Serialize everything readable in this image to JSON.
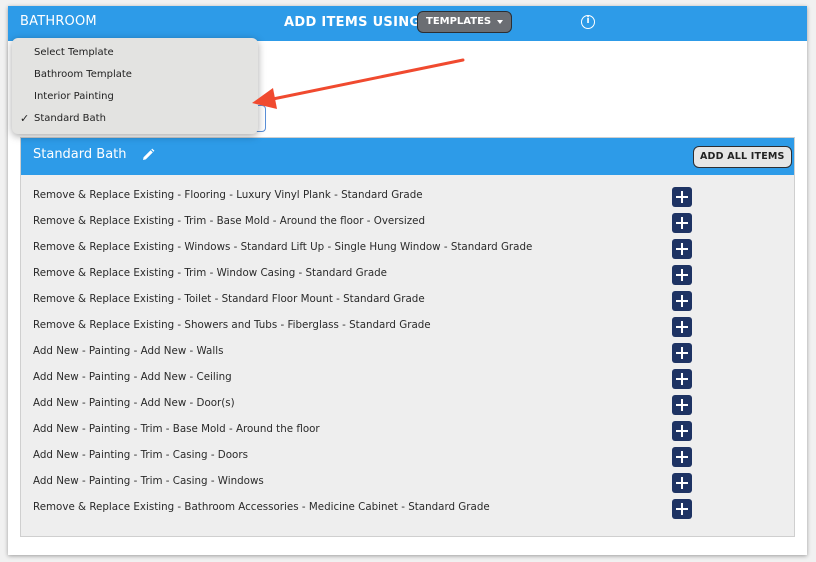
{
  "header": {
    "room_title": "BATHROOM",
    "add_items_label": "ADD ITEMS USING:",
    "templates_button": "TEMPLATES",
    "info_icon_glyph": "i"
  },
  "dropdown": {
    "options": [
      {
        "label": "Select Template",
        "selected": false
      },
      {
        "label": "Bathroom Template",
        "selected": false
      },
      {
        "label": "Interior Painting",
        "selected": false
      },
      {
        "label": "Standard Bath",
        "selected": true
      }
    ],
    "check_glyph": "✓"
  },
  "template_section": {
    "title": "Standard Bath",
    "add_all_button": "ADD ALL ITEMS",
    "items": [
      "Remove & Replace Existing - Flooring - Luxury Vinyl Plank - Standard Grade",
      "Remove & Replace Existing - Trim - Base Mold - Around the floor - Oversized",
      "Remove & Replace Existing - Windows - Standard Lift Up - Single Hung Window - Standard Grade",
      "Remove & Replace Existing - Trim - Window Casing - Standard Grade",
      "Remove & Replace Existing - Toilet - Standard Floor Mount - Standard Grade",
      "Remove & Replace Existing - Showers and Tubs - Fiberglass - Standard Grade",
      "Add New - Painting - Add New - Walls",
      "Add New - Painting - Add New - Ceiling",
      "Add New - Painting - Add New - Door(s)",
      "Add New - Painting - Trim - Base Mold - Around the floor",
      "Add New - Painting - Trim - Casing - Doors",
      "Add New - Painting - Trim - Casing - Windows",
      "Remove & Replace Existing - Bathroom Accessories - Medicine Cabinet - Standard Grade"
    ]
  },
  "colors": {
    "header_blue": "#2d9be8",
    "plus_button_navy": "#1e3363",
    "annotation_arrow": "#f04a2f"
  },
  "icons": {
    "info": "info-icon",
    "caret": "caret-down-icon",
    "pencil": "pencil-icon",
    "plus": "plus-icon",
    "check": "check-icon"
  }
}
